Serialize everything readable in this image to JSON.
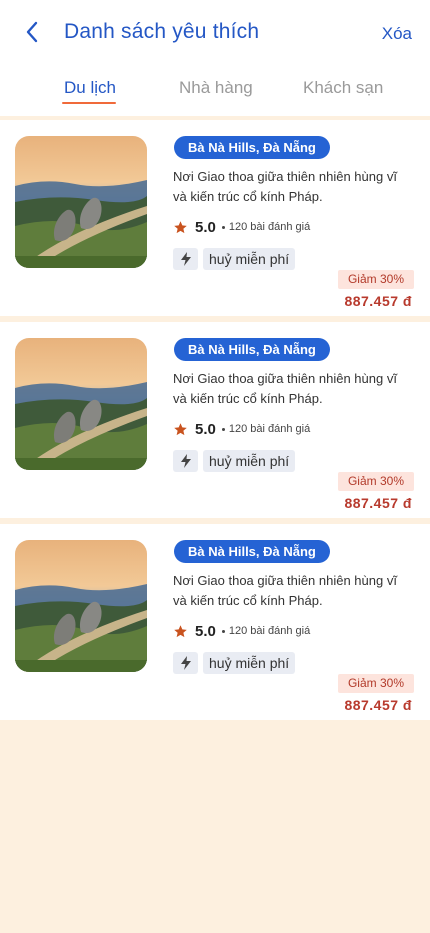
{
  "header": {
    "back_icon": "chevron-left-icon",
    "title": "Danh sách yêu thích",
    "delete_label": "Xóa"
  },
  "tabs": [
    {
      "label": "Du lịch",
      "active": true
    },
    {
      "label": "Nhà hàng",
      "active": false
    },
    {
      "label": "Khách sạn",
      "active": false
    }
  ],
  "colors": {
    "primary": "#2457c5",
    "badge": "#2563d4",
    "accent_underline": "#f06a3a",
    "price": "#b83a2d",
    "star": "#c9531f",
    "background": "#fdf0df"
  },
  "items": [
    {
      "location": "Bà Nà Hills, Đà Nẵng",
      "desc_line1": "Nơi Giao thoa giữa thiên nhiên hùng vĩ",
      "desc_line2": "và kiến trúc cổ kính Pháp.",
      "rating": "5.0",
      "reviews": "120 bài đánh giá",
      "feature_icon": "lightning-icon",
      "feature": "huỷ miễn phí",
      "discount": "Giảm 30%",
      "price": "887.457 đ"
    },
    {
      "location": "Bà Nà Hills, Đà Nẵng",
      "desc_line1": "Nơi Giao thoa giữa thiên nhiên hùng vĩ",
      "desc_line2": "và kiến trúc cổ kính Pháp.",
      "rating": "5.0",
      "reviews": "120 bài đánh giá",
      "feature_icon": "lightning-icon",
      "feature": "huỷ miễn phí",
      "discount": "Giảm 30%",
      "price": "887.457 đ"
    },
    {
      "location": "Bà Nà Hills, Đà Nẵng",
      "desc_line1": "Nơi Giao thoa giữa thiên nhiên hùng vĩ",
      "desc_line2": "và kiến trúc cổ kính Pháp.",
      "rating": "5.0",
      "reviews": "120 bài đánh giá",
      "feature_icon": "lightning-icon",
      "feature": "huỷ miễn phí",
      "discount": "Giảm 30%",
      "price": "887.457 đ"
    }
  ]
}
